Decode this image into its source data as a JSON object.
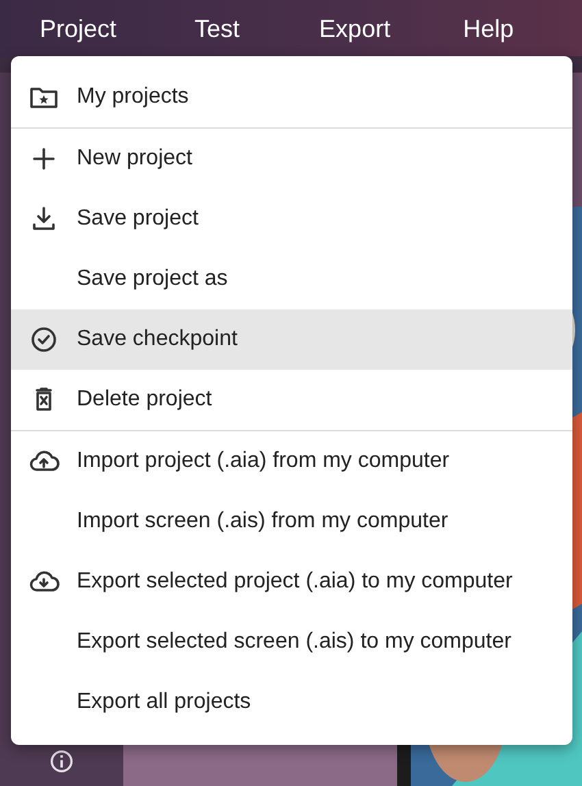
{
  "menubar": [
    {
      "label": "Project"
    },
    {
      "label": "Test"
    },
    {
      "label": "Export"
    },
    {
      "label": "Help"
    }
  ],
  "menu": {
    "sections": [
      [
        {
          "label": "My projects",
          "kind": "folder-star",
          "selected": false
        }
      ],
      [
        {
          "label": "New project",
          "kind": "plus",
          "selected": false
        },
        {
          "label": "Save project",
          "kind": "download",
          "selected": false
        },
        {
          "label": "Save project as",
          "selected": false
        },
        {
          "label": "Save checkpoint",
          "kind": "check-circle",
          "selected": true
        },
        {
          "label": "Delete project",
          "kind": "trash",
          "selected": false
        }
      ],
      [
        {
          "label": "Import project (.aia) from my computer",
          "kind": "cloud-upload",
          "selected": false
        },
        {
          "label": "Import screen (.ais) from my computer",
          "selected": false
        },
        {
          "label": "Export selected project (.aia) to my computer",
          "kind": "cloud-download",
          "selected": false
        },
        {
          "label": "Export selected screen (.ais) to my computer",
          "selected": false
        },
        {
          "label": "Export all projects",
          "selected": false
        }
      ]
    ]
  }
}
